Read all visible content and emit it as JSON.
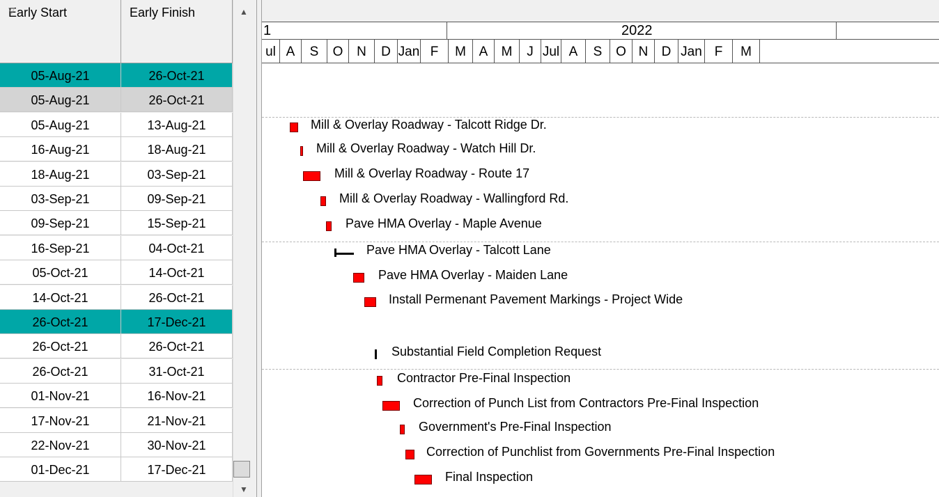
{
  "columns": {
    "early_start": "Early Start",
    "early_finish": "Early Finish"
  },
  "rows": [
    {
      "start": "05-Aug-21",
      "finish": "26-Oct-21",
      "style": "teal"
    },
    {
      "start": "05-Aug-21",
      "finish": "26-Oct-21",
      "style": "grey"
    },
    {
      "start": "05-Aug-21",
      "finish": "13-Aug-21",
      "style": "plain"
    },
    {
      "start": "16-Aug-21",
      "finish": "18-Aug-21",
      "style": "plain"
    },
    {
      "start": "18-Aug-21",
      "finish": "03-Sep-21",
      "style": "plain"
    },
    {
      "start": "03-Sep-21",
      "finish": "09-Sep-21",
      "style": "plain"
    },
    {
      "start": "09-Sep-21",
      "finish": "15-Sep-21",
      "style": "plain"
    },
    {
      "start": "16-Sep-21",
      "finish": "04-Oct-21",
      "style": "plain"
    },
    {
      "start": "05-Oct-21",
      "finish": "14-Oct-21",
      "style": "plain"
    },
    {
      "start": "14-Oct-21",
      "finish": "26-Oct-21",
      "style": "plain"
    },
    {
      "start": "26-Oct-21",
      "finish": "17-Dec-21",
      "style": "teal"
    },
    {
      "start": "26-Oct-21",
      "finish": "26-Oct-21",
      "style": "plain"
    },
    {
      "start": "26-Oct-21",
      "finish": "31-Oct-21",
      "style": "plain"
    },
    {
      "start": "01-Nov-21",
      "finish": "16-Nov-21",
      "style": "plain"
    },
    {
      "start": "17-Nov-21",
      "finish": "21-Nov-21",
      "style": "plain"
    },
    {
      "start": "22-Nov-21",
      "finish": "30-Nov-21",
      "style": "plain"
    },
    {
      "start": "01-Dec-21",
      "finish": "17-Dec-21",
      "style": "plain"
    }
  ],
  "timescale": {
    "years": [
      "1",
      "2022"
    ],
    "months": [
      "ul",
      "A",
      "S",
      "O",
      "N",
      "D",
      "Jan",
      "F",
      "M",
      "A",
      "M",
      "J",
      "Jul",
      "A",
      "S",
      "O",
      "N",
      "D",
      "Jan",
      "F",
      "M"
    ]
  },
  "tasks": [
    {
      "label": "Mill & Overlay Roadway - Talcott Ridge Dr.",
      "kind": "bar"
    },
    {
      "label": "Mill & Overlay Roadway - Watch Hill Dr.",
      "kind": "bar"
    },
    {
      "label": "Mill  & Overlay Roadway - Route 17",
      "kind": "bar"
    },
    {
      "label": "Mill & Overlay Roadway - Wallingford Rd.",
      "kind": "bar"
    },
    {
      "label": "Pave HMA Overlay - Maple Avenue",
      "kind": "bar"
    },
    {
      "label": "Pave HMA Overlay - Talcott Lane",
      "kind": "summary"
    },
    {
      "label": "Pave HMA Overlay - Maiden Lane",
      "kind": "bar"
    },
    {
      "label": "Install Permenant Pavement Markings - Project Wide",
      "kind": "bar"
    },
    {
      "label": "Substantial Field Completion Request",
      "kind": "milestone"
    },
    {
      "label": "Contractor Pre-Final Inspection",
      "kind": "bar"
    },
    {
      "label": "Correction of Punch List from Contractors Pre-Final Inspection",
      "kind": "bar"
    },
    {
      "label": "Government's Pre-Final Inspection",
      "kind": "bar"
    },
    {
      "label": "Correction of Punchlist from Governments Pre-Final Inspection",
      "kind": "bar"
    },
    {
      "label": "Final Inspection",
      "kind": "bar"
    }
  ],
  "colors": {
    "teal": "#00a7a7",
    "grey": "#d4d4d4",
    "bar": "#ff0000"
  }
}
